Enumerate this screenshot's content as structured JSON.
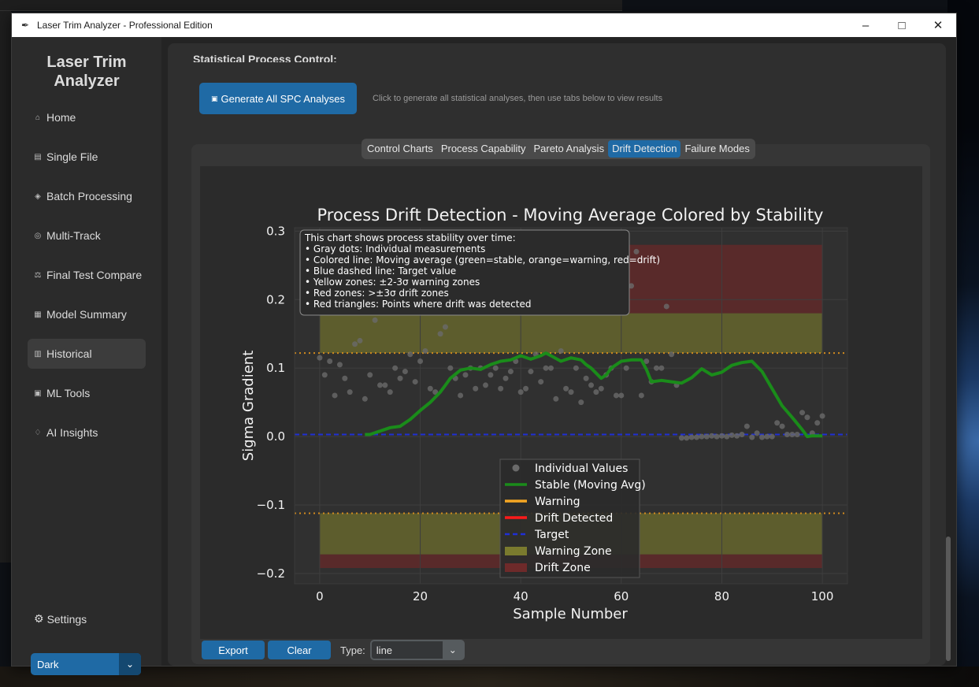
{
  "window": {
    "title": "Laser Trim Analyzer - Professional Edition",
    "controls": [
      "–",
      "□",
      "✕"
    ]
  },
  "sidebar": {
    "brand_line1": "Laser Trim",
    "brand_line2": "Analyzer",
    "items": [
      {
        "label": "Home",
        "icon": "home-icon"
      },
      {
        "label": "Single File",
        "icon": "file-icon"
      },
      {
        "label": "Batch Processing",
        "icon": "batch-icon"
      },
      {
        "label": "Multi-Track",
        "icon": "multitrack-icon"
      },
      {
        "label": "Final Test Compare",
        "icon": "compare-icon"
      },
      {
        "label": "Model Summary",
        "icon": "summary-icon"
      },
      {
        "label": "Historical",
        "icon": "history-icon",
        "active": true
      },
      {
        "label": "ML Tools",
        "icon": "ml-icon"
      },
      {
        "label": "AI Insights",
        "icon": "ai-icon"
      }
    ],
    "settings_label": "Settings",
    "theme_value": "Dark"
  },
  "main": {
    "section_title": "Statistical Process Control:",
    "generate_button": "Generate All SPC Analyses",
    "generate_hint": "Click to generate all statistical analyses, then use tabs below to view results",
    "tabs": [
      {
        "label": "Control Charts"
      },
      {
        "label": "Process Capability"
      },
      {
        "label": "Pareto Analysis"
      },
      {
        "label": "Drift Detection",
        "active": true
      },
      {
        "label": "Failure Modes"
      }
    ],
    "export_label": "Export",
    "clear_label": "Clear",
    "type_label": "Type:",
    "type_value": "line"
  },
  "chart_data": {
    "type": "line",
    "title": "Process Drift Detection - Moving Average Colored by Stability",
    "xlabel": "Sample Number",
    "ylabel": "Sigma Gradient",
    "xlim": [
      -5,
      105
    ],
    "ylim": [
      -0.215,
      0.305
    ],
    "x_ticks": [
      "0",
      "20",
      "40",
      "60",
      "80",
      "100"
    ],
    "y_ticks": [
      "0.3",
      "0.2",
      "0.1",
      "0.0",
      "−0.1",
      "−0.2"
    ],
    "target": 0.003,
    "warning_limits": [
      -0.112,
      0.122
    ],
    "warning_zones": [
      [
        0.122,
        0.18
      ],
      [
        -0.172,
        -0.112
      ]
    ],
    "drift_zones": [
      [
        0.18,
        0.28
      ],
      [
        -0.192,
        -0.172
      ]
    ],
    "zones_x_range": [
      0,
      100
    ],
    "info_box": [
      "This chart shows process stability over time:",
      "• Gray dots: Individual measurements",
      "• Colored line: Moving average (green=stable, orange=warning, red=drift)",
      "• Blue dashed line: Target value",
      "• Yellow zones: ±2-3σ warning zones",
      "• Red zones: >±3σ drift zones",
      "• Red triangles: Points where drift was detected"
    ],
    "legend": [
      {
        "label": "Individual Values",
        "kind": "dot",
        "color": "#6a6a6a"
      },
      {
        "label": "Stable (Moving Avg)",
        "kind": "line",
        "color": "#1a8c1a"
      },
      {
        "label": "Warning",
        "kind": "line",
        "color": "#f5a623"
      },
      {
        "label": "Drift Detected",
        "kind": "line",
        "color": "#ff1a1a"
      },
      {
        "label": "Target",
        "kind": "dash",
        "color": "#1f2fd6"
      },
      {
        "label": "Warning Zone",
        "kind": "patch",
        "color": "#7a7a2e"
      },
      {
        "label": "Drift Zone",
        "kind": "patch",
        "color": "#6e2a2a"
      }
    ],
    "legend_position": "lower-center",
    "series": [
      {
        "name": "Stable (Moving Avg)",
        "color": "#1a8c1a",
        "x": [
          9,
          10,
          12,
          14,
          16,
          18,
          20,
          22,
          24,
          25,
          26,
          28,
          30,
          32,
          34,
          36,
          38,
          40,
          42,
          44,
          45,
          46,
          48,
          50,
          52,
          53,
          54,
          56,
          57,
          58,
          60,
          62,
          64,
          65,
          66,
          68,
          70,
          72,
          74,
          76,
          78,
          80,
          82,
          84,
          86,
          88,
          90,
          92,
          94,
          96,
          97,
          98,
          100
        ],
        "y": [
          0.003,
          0.003,
          0.008,
          0.013,
          0.015,
          0.025,
          0.038,
          0.05,
          0.065,
          0.075,
          0.085,
          0.097,
          0.1,
          0.098,
          0.105,
          0.11,
          0.112,
          0.118,
          0.113,
          0.118,
          0.122,
          0.118,
          0.11,
          0.115,
          0.112,
          0.105,
          0.1,
          0.085,
          0.09,
          0.1,
          0.11,
          0.112,
          0.112,
          0.098,
          0.08,
          0.082,
          0.08,
          0.078,
          0.086,
          0.099,
          0.09,
          0.094,
          0.104,
          0.108,
          0.11,
          0.095,
          0.07,
          0.045,
          0.028,
          0.01,
          0.0,
          0.001,
          0.001
        ]
      }
    ],
    "points": {
      "name": "Individual Values",
      "x": [
        0,
        1,
        2,
        3,
        4,
        5,
        6,
        7,
        8,
        9,
        10,
        11,
        12,
        13,
        14,
        15,
        16,
        17,
        18,
        19,
        20,
        21,
        22,
        23,
        24,
        25,
        26,
        27,
        28,
        29,
        30,
        31,
        32,
        33,
        34,
        35,
        36,
        37,
        38,
        39,
        40,
        41,
        42,
        43,
        44,
        45,
        46,
        47,
        48,
        49,
        50,
        51,
        52,
        53,
        54,
        55,
        56,
        57,
        58,
        59,
        60,
        61,
        62,
        63,
        64,
        65,
        66,
        67,
        68,
        69,
        70,
        71,
        72,
        73,
        74,
        75,
        76,
        77,
        78,
        79,
        80,
        81,
        82,
        83,
        84,
        85,
        86,
        87,
        88,
        89,
        90,
        91,
        92,
        93,
        94,
        95,
        96,
        97,
        98,
        99,
        100
      ],
      "y": [
        0.115,
        0.09,
        0.11,
        0.06,
        0.105,
        0.085,
        0.065,
        0.135,
        0.14,
        0.055,
        0.09,
        0.17,
        0.075,
        0.075,
        0.065,
        0.1,
        0.085,
        0.095,
        0.12,
        0.08,
        0.11,
        0.125,
        0.07,
        0.065,
        0.15,
        0.16,
        0.1,
        0.085,
        0.06,
        0.09,
        0.1,
        0.07,
        0.1,
        0.075,
        0.09,
        0.1,
        0.07,
        0.085,
        0.095,
        0.11,
        0.065,
        0.07,
        0.095,
        0.12,
        0.08,
        0.1,
        0.1,
        0.055,
        0.125,
        0.07,
        0.065,
        0.1,
        0.05,
        0.085,
        0.075,
        0.065,
        0.07,
        0.09,
        0.1,
        0.06,
        0.06,
        0.1,
        0.22,
        0.27,
        0.06,
        0.11,
        0.08,
        0.1,
        0.1,
        0.19,
        0.12,
        0.075,
        -0.002,
        -0.002,
        -0.001,
        -0.001,
        0.0,
        0.0,
        0.001,
        0.0,
        0.001,
        0.0,
        0.002,
        0.001,
        0.003,
        0.015,
        -0.001,
        0.005,
        -0.001,
        0.0,
        0.0,
        0.02,
        0.015,
        0.003,
        0.003,
        0.003,
        0.035,
        0.028,
        0.005,
        0.02,
        0.03
      ]
    }
  }
}
